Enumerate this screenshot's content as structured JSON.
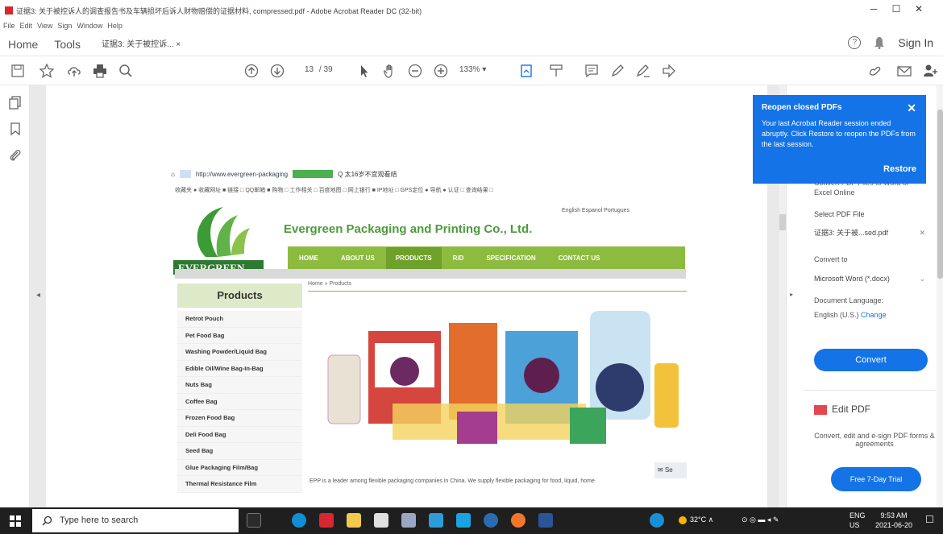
{
  "window": {
    "title": "证据3: 关于被控诉人的调查报告书及车辆损坏后诉人财物赔偿的证据材料, compressed.pdf - Adobe Acrobat Reader DC (32-bit)",
    "minimize_glyph": "─",
    "maximize_glyph": "☐",
    "close_glyph": "✕"
  },
  "menu": [
    "File",
    "Edit",
    "View",
    "Sign",
    "Window",
    "Help"
  ],
  "tabs": {
    "home": "Home",
    "tools": "Tools",
    "doc_tab": "证据3: 关于被控诉...  ×",
    "help_glyph": "?",
    "sign_in": "Sign In"
  },
  "toolbar": {
    "page_current": "13",
    "page_total": "/ 39",
    "zoom": "133%  ▾"
  },
  "embedded_page": {
    "url": "http://www.evergreen-packaging",
    "search_text": "Q 太16岁不宜观看结",
    "favorites": "收藏夹  ● 收藏网址  ■ 链接  □ QQ邮箱  ■ 购物  □ 工作相关  □ 百度地图  □ 网上银行  ■ IP地址  □ GPS定位  ● 导航  ● 认证  □ 查询结果  □",
    "logo_text": "EVERGREEN",
    "company": "Evergreen Packaging and Printing Co., Ltd.",
    "languages": "English  Espanol  Portugues",
    "nav": [
      "HOME",
      "ABOUT US",
      "PRODUCTS",
      "R/D",
      "SPECIFICATION",
      "CONTACT US"
    ],
    "sidebar_title": "Products",
    "products": [
      "Retrot Pouch",
      "Pet Food Bag",
      "Washing Powder/Liquid Bag",
      "Edible Oil/Wine Bag-In-Bag",
      "Nuts Bag",
      "Coffee Bag",
      "Frozen Food Bag",
      "Deli Food Bag",
      "Seed Bag",
      "Glue Packaging Film/Bag",
      "Thermal Resistance Film"
    ],
    "breadcrumb": "Home » Products",
    "intro": "EPP is a leader among flexible packaging companies in China. We supply flexible packaging for food, liquid, home",
    "send": "Se"
  },
  "right_panel": {
    "convert_desc": "Convert PDF Files to Word or Excel Online",
    "select_label": "Select PDF File",
    "selected_file": "证据3: 关于被...sed.pdf",
    "convert_to_label": "Convert to",
    "convert_to_value": "Microsoft Word (*.docx)",
    "doc_lang_label": "Document Language:",
    "doc_lang_value": "English (U.S.)",
    "change": "Change",
    "convert_btn": "Convert",
    "edit_pdf": "Edit PDF",
    "edit_desc": "Convert, edit and e-sign PDF forms & agreements",
    "trial_btn": "Free 7-Day Trial"
  },
  "popup": {
    "title": "Reopen closed PDFs",
    "text": "Your last Acrobat Reader session ended abruptly. Click Restore to reopen the PDFs from the last session.",
    "close": "✕",
    "restore": "Restore"
  },
  "taskbar": {
    "search_placeholder": "Type here to search",
    "weather": "32°C  ∧",
    "lang1": "ENG",
    "lang2": "US",
    "time": "9:53 AM",
    "date": "2021-06-20"
  }
}
